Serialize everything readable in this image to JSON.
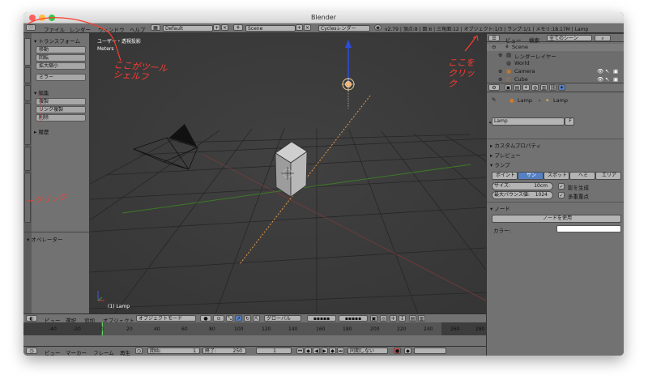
{
  "window": {
    "title": "Blender"
  },
  "info_bar": {
    "menus": [
      "ファイル",
      "レンダー",
      "ウィンドウ",
      "ヘルプ"
    ],
    "layout": "Default",
    "scene": "Scene",
    "engine": "Cyclesレンダー",
    "stats": "v2.79 | 頂点:8 | 面:6 | 三角面:12 | オブジェクト:1/3 | ランプ:1/1 | メモリ:18.17M | Lamp"
  },
  "tool_shelf": {
    "tabs": [
      "ツール",
      "作成",
      "関係",
      "アニメーション",
      "物理演算",
      "グリースペンシル"
    ],
    "transform": {
      "title": "トランスフォーム",
      "buttons": [
        "移動",
        "回転",
        "拡大縮小",
        "ミラー"
      ]
    },
    "edit": {
      "title": "編集",
      "buttons": [
        "複製",
        "リンク複製",
        "削除"
      ]
    },
    "history": {
      "title": "履歴"
    },
    "operator": {
      "title": "オペレーター"
    }
  },
  "viewport": {
    "view_name": "ユーザー・透視投影",
    "units": "Meters",
    "active": "(1) Lamp"
  },
  "view3d_header": {
    "menus": [
      "ビュー",
      "選択",
      "追加",
      "オブジェクト"
    ],
    "mode": "オブジェクトモード",
    "orientation": "グローバル"
  },
  "timeline": {
    "ticks": [
      "-40",
      "-20",
      "0",
      "20",
      "40",
      "60",
      "80",
      "100",
      "120",
      "140",
      "160",
      "180",
      "200",
      "220",
      "240",
      "260",
      "280"
    ],
    "menus": [
      "ビュー",
      "マーカー",
      "フレーム",
      "再生"
    ],
    "start_label": "開始:",
    "start": "1",
    "end_label": "終了:",
    "end": "250",
    "current": "1",
    "sync": "同期しない"
  },
  "outliner": {
    "menus": [
      "ビュー",
      "検索"
    ],
    "filter": "全てのシーン",
    "items": [
      "Scene",
      "レンダーレイヤー",
      "World",
      "Camera",
      "Cube"
    ]
  },
  "properties": {
    "breadcrumb": [
      "Lamp",
      "Lamp"
    ],
    "name": "Lamp",
    "fake": "F",
    "panels": {
      "custom": "カスタムプロパティ",
      "preview": "プレビュー",
      "lamp": "ランプ",
      "nodes": "ノード"
    },
    "lamp_types": [
      "ポイント",
      "サン",
      "スポット",
      "ヘミ",
      "エリア"
    ],
    "active_type": "サン",
    "size_label": "サイズ:",
    "size": "10cm",
    "bounces_label": "最大バウンス値:",
    "bounces": "1024",
    "cast_shadow": "影を生成",
    "mis": "多重重点",
    "use_nodes": "ノードを使用",
    "color_label": "カラー:"
  },
  "annotations": {
    "toolshelf_note": "ここがツールシェルフ",
    "click_here": "ここをクリック",
    "tab_click": "←クリック"
  },
  "colors": {
    "accent": "#5680c2",
    "annotation": "#ff3b2f",
    "viewport_bg": "#3d3d3d"
  }
}
